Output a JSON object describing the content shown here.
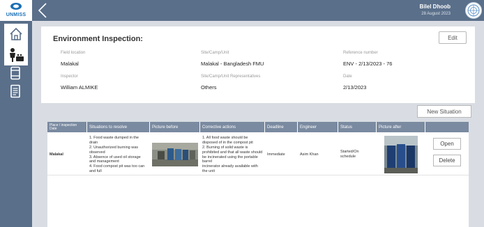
{
  "app": {
    "logo_text": "UNMISS",
    "user_name": "Bilel Dhoob",
    "user_date": "28 August 2023"
  },
  "colors": {
    "rail": "#5a6f8a",
    "table_header": "#7a8aa0",
    "content_bg": "#d9dde3",
    "logo_blue": "#1a6fb5"
  },
  "nav": {
    "items": [
      {
        "icon": "home-icon"
      },
      {
        "icon": "inspector-person-icon"
      },
      {
        "icon": "container-icon"
      },
      {
        "icon": "document-icon"
      }
    ]
  },
  "inspection": {
    "title": "Environment Inspection:",
    "edit_label": "Edit",
    "fields": {
      "field_location_label": "Field location",
      "field_location_value": "Malakal",
      "site_camp_label": "Site/Camp/Unit",
      "site_camp_value": "Malakal - Bangladesh FMU",
      "reference_label": "Reference number",
      "reference_value": "ENV - 2/13/2023 - 76",
      "inspector_label": "Inspector",
      "inspector_value": "William ALMIKE",
      "representatives_label": "Site/Camp/Unit Representatives",
      "representatives_value": "Others",
      "date_label": "Date",
      "date_value": "2/13/2023"
    }
  },
  "situations": {
    "new_label": "New Situation",
    "headers": {
      "place": "Place / inspection Date",
      "situations": "Situations to resolve",
      "picture_before": "Picture before",
      "corrective": "Corrective actions",
      "deadline": "Deadline",
      "engineer": "Engineer",
      "status": "Status",
      "picture_after": "Picture after"
    },
    "rows": [
      {
        "place": "Malakal",
        "situations": "1. Food waste dumped in the drain\n2. Unauthorized burning was observed\n3. Absence of used oil storage and management\n4. Food compost pit was too can and full",
        "corrective": "1. All food waste should be disposed of in the compost pit\n2. Burning of solid waste is prohibited and that all waste should be incinerated using the portable barrel\n   incinerator already available with the unit",
        "deadline": "Immediate",
        "engineer": "Asim Khan",
        "status": "Started/On schedule",
        "open_label": "Open",
        "delete_label": "Delete"
      }
    ]
  }
}
